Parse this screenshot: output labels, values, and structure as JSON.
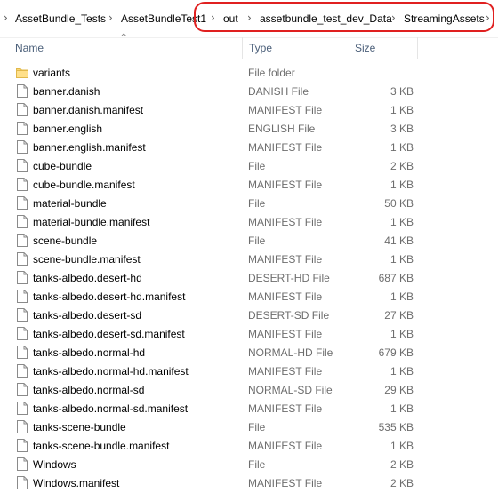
{
  "breadcrumb": {
    "parts": [
      "AssetBundle_Tests",
      "AssetBundleTest1",
      "out",
      "assetbundle_test_dev_Data",
      "StreamingAssets"
    ],
    "separator": "›",
    "highlight_color": "#e02020"
  },
  "columns": {
    "name": "Name",
    "type": "Type",
    "size": "Size"
  },
  "files": [
    {
      "name": "variants",
      "type": "File folder",
      "size": "",
      "icon": "folder-icon"
    },
    {
      "name": "banner.danish",
      "type": "DANISH File",
      "size": "3 KB",
      "icon": "file-icon"
    },
    {
      "name": "banner.danish.manifest",
      "type": "MANIFEST File",
      "size": "1 KB",
      "icon": "file-icon"
    },
    {
      "name": "banner.english",
      "type": "ENGLISH File",
      "size": "3 KB",
      "icon": "file-icon"
    },
    {
      "name": "banner.english.manifest",
      "type": "MANIFEST File",
      "size": "1 KB",
      "icon": "file-icon"
    },
    {
      "name": "cube-bundle",
      "type": "File",
      "size": "2 KB",
      "icon": "file-icon"
    },
    {
      "name": "cube-bundle.manifest",
      "type": "MANIFEST File",
      "size": "1 KB",
      "icon": "file-icon"
    },
    {
      "name": "material-bundle",
      "type": "File",
      "size": "50 KB",
      "icon": "file-icon"
    },
    {
      "name": "material-bundle.manifest",
      "type": "MANIFEST File",
      "size": "1 KB",
      "icon": "file-icon"
    },
    {
      "name": "scene-bundle",
      "type": "File",
      "size": "41 KB",
      "icon": "file-icon"
    },
    {
      "name": "scene-bundle.manifest",
      "type": "MANIFEST File",
      "size": "1 KB",
      "icon": "file-icon"
    },
    {
      "name": "tanks-albedo.desert-hd",
      "type": "DESERT-HD File",
      "size": "687 KB",
      "icon": "file-icon"
    },
    {
      "name": "tanks-albedo.desert-hd.manifest",
      "type": "MANIFEST File",
      "size": "1 KB",
      "icon": "file-icon"
    },
    {
      "name": "tanks-albedo.desert-sd",
      "type": "DESERT-SD File",
      "size": "27 KB",
      "icon": "file-icon"
    },
    {
      "name": "tanks-albedo.desert-sd.manifest",
      "type": "MANIFEST File",
      "size": "1 KB",
      "icon": "file-icon"
    },
    {
      "name": "tanks-albedo.normal-hd",
      "type": "NORMAL-HD File",
      "size": "679 KB",
      "icon": "file-icon"
    },
    {
      "name": "tanks-albedo.normal-hd.manifest",
      "type": "MANIFEST File",
      "size": "1 KB",
      "icon": "file-icon"
    },
    {
      "name": "tanks-albedo.normal-sd",
      "type": "NORMAL-SD File",
      "size": "29 KB",
      "icon": "file-icon"
    },
    {
      "name": "tanks-albedo.normal-sd.manifest",
      "type": "MANIFEST File",
      "size": "1 KB",
      "icon": "file-icon"
    },
    {
      "name": "tanks-scene-bundle",
      "type": "File",
      "size": "535 KB",
      "icon": "file-icon"
    },
    {
      "name": "tanks-scene-bundle.manifest",
      "type": "MANIFEST File",
      "size": "1 KB",
      "icon": "file-icon"
    },
    {
      "name": "Windows",
      "type": "File",
      "size": "2 KB",
      "icon": "file-icon"
    },
    {
      "name": "Windows.manifest",
      "type": "MANIFEST File",
      "size": "2 KB",
      "icon": "file-icon"
    }
  ]
}
